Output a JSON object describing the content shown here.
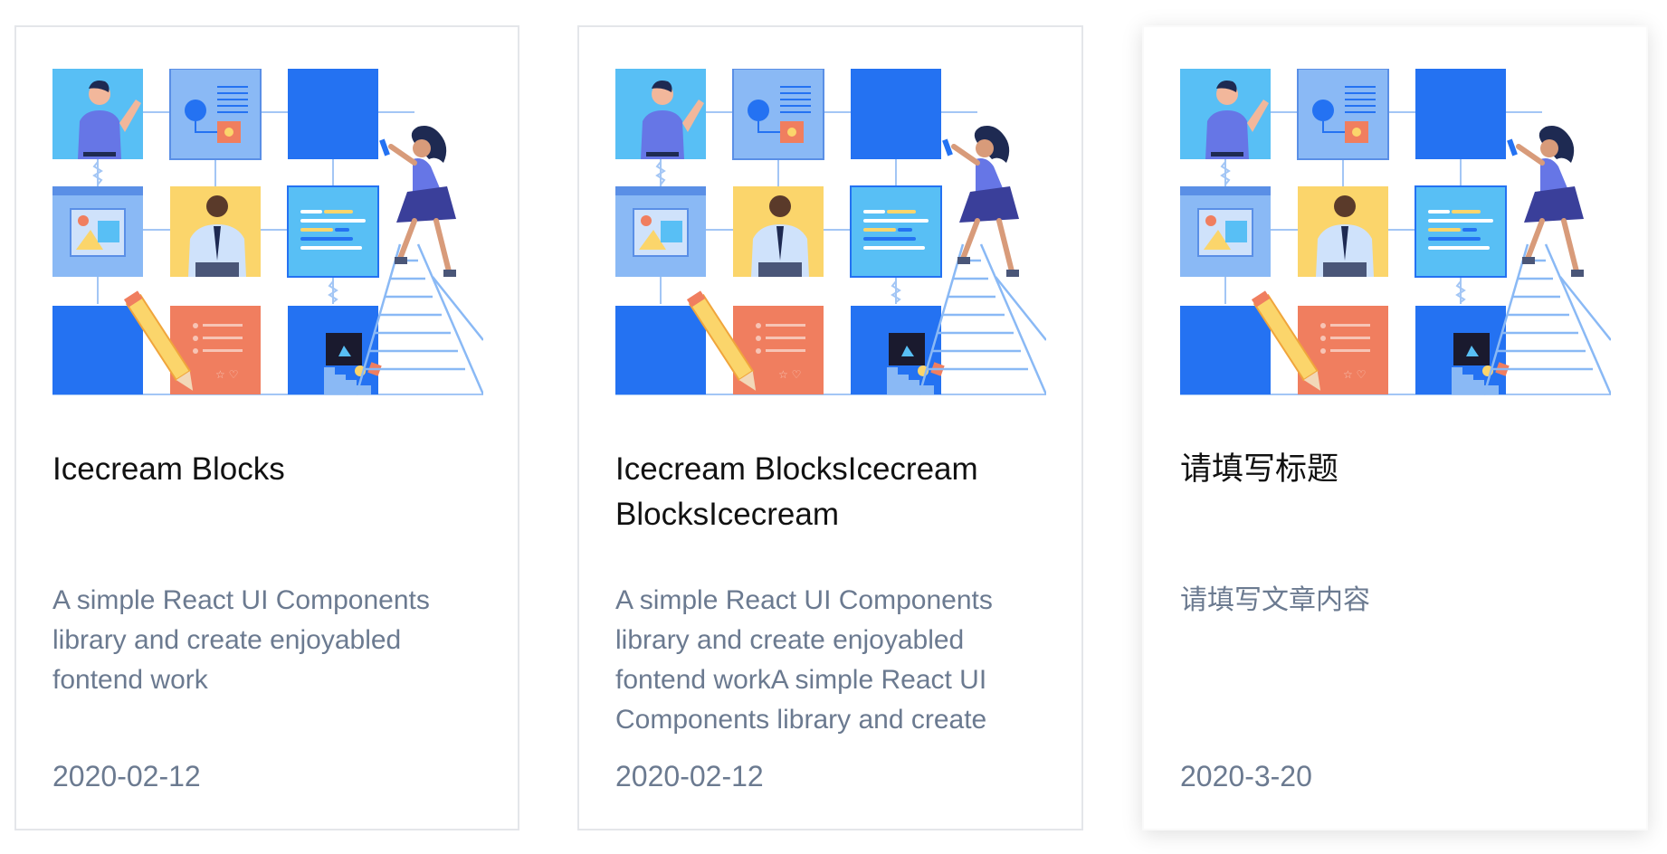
{
  "cards": [
    {
      "title": "Icecream Blocks",
      "description": "A simple React UI Components library and create enjoyabled fontend work",
      "date": "2020-02-12"
    },
    {
      "title": "Icecream BlocksIcecream BlocksIcecream",
      "description": "A simple React UI Components library and create enjoyabled fontend workA simple React UI Components library and create",
      "date": "2020-02-12"
    },
    {
      "title": "请填写标题",
      "description": "请填写文章内容",
      "date": "2020-3-20"
    }
  ],
  "colors": {
    "primary_blue": "#2472f2",
    "light_blue": "#8ab9f5",
    "sky_blue": "#58bff5",
    "yellow": "#fbd56b",
    "coral": "#f07e5f",
    "line_blue": "#a3c6f5",
    "description_text": "#6b7a90",
    "card_border": "#e4e6ea"
  },
  "icons": {
    "illustration": "team-building-blocks-illustration"
  }
}
